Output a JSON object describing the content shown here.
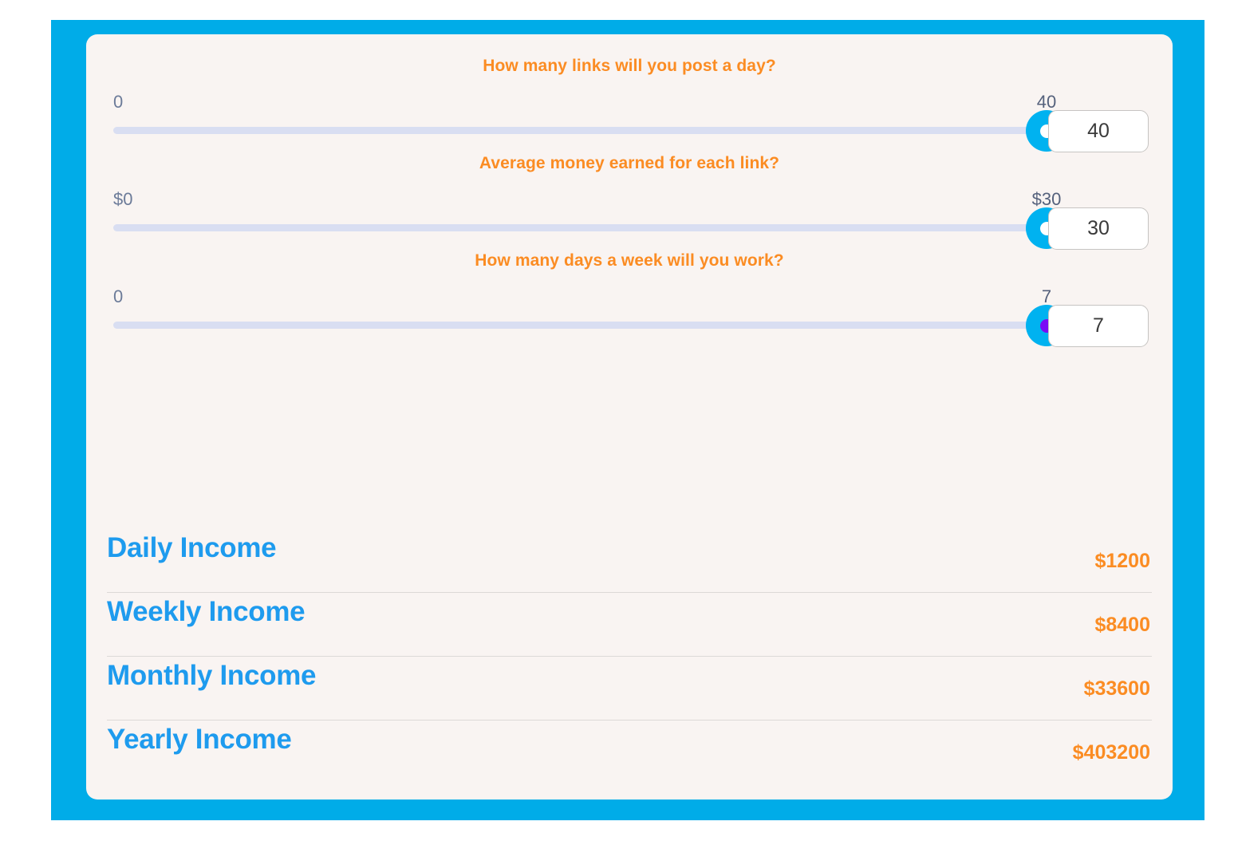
{
  "theme": {
    "frame_color": "#00ACE8",
    "card_background": "#F9F4F2",
    "accent_orange": "#FB8C23",
    "accent_blue": "#1E9BEE",
    "slider_handle_color": "#00B2F0",
    "slider_track_color": "#D9DEF2",
    "focus_dot_color": "#7A0BF5",
    "label_gray": "#6C7B99"
  },
  "sliders": [
    {
      "question": "How many links will you post a day?",
      "min_label": "0",
      "max_label": "40",
      "value": "40",
      "min": 0,
      "max": 40,
      "current": 40,
      "focused": false
    },
    {
      "question": "Average money earned for each link?",
      "min_label": "$0",
      "max_label": "$30",
      "value": "30",
      "min": 0,
      "max": 30,
      "current": 30,
      "focused": false
    },
    {
      "question": "How many days a week will you work?",
      "min_label": "0",
      "max_label": "7",
      "value": "7",
      "min": 0,
      "max": 7,
      "current": 7,
      "focused": true
    }
  ],
  "income": [
    {
      "label": "Daily Income",
      "value": "$1200"
    },
    {
      "label": "Weekly Income",
      "value": "$8400"
    },
    {
      "label": "Monthly Income",
      "value": "$33600"
    },
    {
      "label": "Yearly Income",
      "value": "$403200"
    }
  ]
}
